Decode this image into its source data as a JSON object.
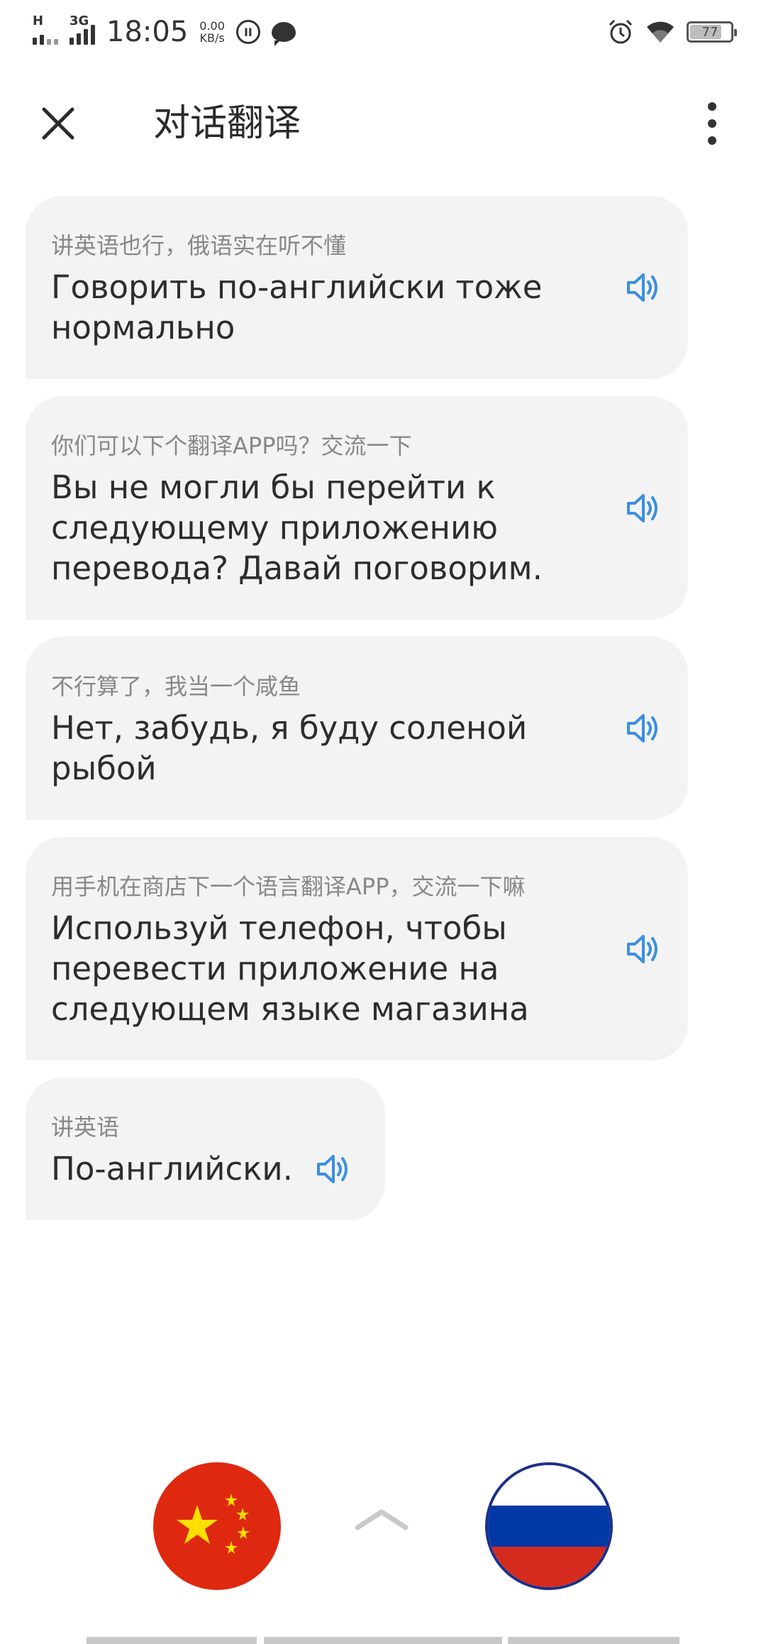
{
  "status_bar": {
    "network_1": "H",
    "network_2": "3G",
    "time": "18:05",
    "net_speed_value": "0.00",
    "net_speed_unit": "KB/s",
    "battery": "77",
    "icons": [
      "signal-icon",
      "data-saver-icon",
      "chat-notification-icon",
      "alarm-icon",
      "wifi-icon",
      "battery-icon"
    ]
  },
  "header": {
    "title": "对话翻译",
    "close_icon": "close-icon",
    "menu_icon": "more-vertical-icon"
  },
  "conversation": {
    "messages": [
      {
        "source": "讲英语也行，俄语实在听不懂",
        "translation": "Говорить по-английски тоже нормально"
      },
      {
        "source": "你们可以下个翻译APP吗？交流一下",
        "translation": "Вы не могли бы перейти к следующему приложению перевода? Давай поговорим."
      },
      {
        "source": "不行算了，我当一个咸鱼",
        "translation": "Нет, забудь, я буду соленой рыбой"
      },
      {
        "source": "用手机在商店下一个语言翻译APP，交流一下嘛",
        "translation": "Используй телефон, чтобы перевести приложение на следующем языке магазина"
      },
      {
        "source": "讲英语",
        "translation": "По-английски."
      }
    ],
    "speaker_icon": "speaker-icon"
  },
  "language_bar": {
    "left_flag": "china-flag-icon",
    "right_flag": "russia-flag-icon",
    "toggle_icon": "chevron-up-icon"
  },
  "colors": {
    "bubble_bg": "#f3f3f3",
    "speaker_blue": "#3b8fe0",
    "source_text": "#888888",
    "target_text": "#2d2d2d",
    "china_red": "#de2910",
    "china_yellow": "#ffde00",
    "russia_blue": "#0039a6",
    "russia_red": "#d52b1e"
  }
}
